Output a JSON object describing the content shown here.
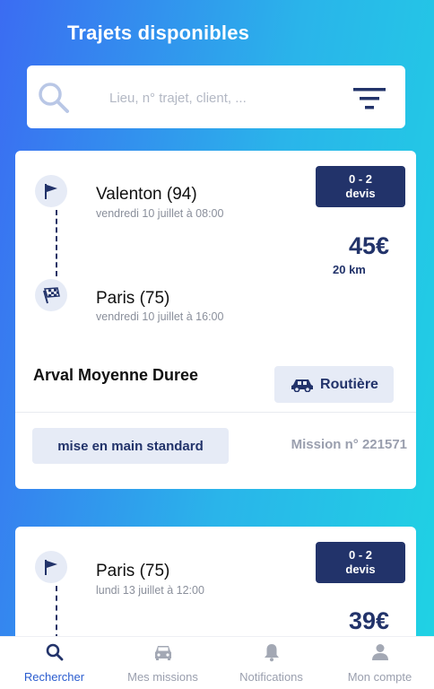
{
  "header": {
    "title": "Trajets disponibles"
  },
  "search": {
    "placeholder": "Lieu, n° trajet, client, ..."
  },
  "trips": [
    {
      "origin_city": "Valenton (94)",
      "origin_date": "vendredi 10 juillet à 08:00",
      "destination_city": "Paris (75)",
      "destination_date": "vendredi 10 juillet à 16:00",
      "devis_range": "0 - 2",
      "devis_label": "devis",
      "price": "45€",
      "distance": "20 km",
      "client": "Arval Moyenne Duree",
      "transport_type": "Routière",
      "service": "mise en main standard",
      "mission": "Mission n° 221571"
    },
    {
      "origin_city": "Paris (75)",
      "origin_date": "lundi 13 juillet à 12:00",
      "devis_range": "0 - 2",
      "devis_label": "devis",
      "price": "39€"
    }
  ],
  "nav": {
    "items": [
      {
        "label": "Rechercher",
        "icon": "search-icon",
        "active": true
      },
      {
        "label": "Mes missions",
        "icon": "car-icon",
        "active": false
      },
      {
        "label": "Notifications",
        "icon": "bell-icon",
        "active": false
      },
      {
        "label": "Mon compte",
        "icon": "user-icon",
        "active": false
      }
    ]
  },
  "colors": {
    "accent": "#22336a",
    "active_nav": "#2a5ccf",
    "pill_bg": "#e6ebf6",
    "gradient_start": "#3b6cf2",
    "gradient_end": "#1fd3e3"
  }
}
